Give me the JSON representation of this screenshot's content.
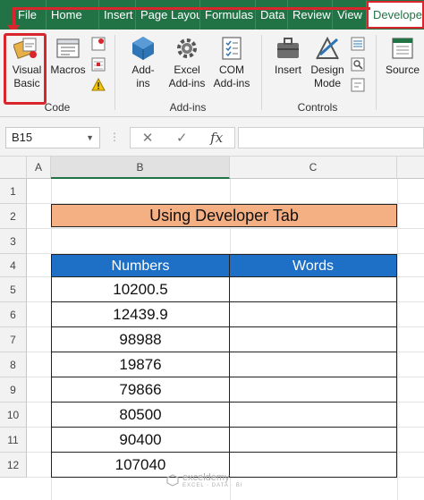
{
  "ribbon": {
    "tabs": [
      "File",
      "Home",
      "Insert",
      "Page Layou",
      "Formulas",
      "Data",
      "Review",
      "View",
      "Developer"
    ],
    "groups": {
      "code": {
        "label": "Code",
        "visual_basic_line1": "Visual",
        "visual_basic_line2": "Basic",
        "macros": "Macros"
      },
      "addins": {
        "label": "Add-ins",
        "addins_line1": "Add-",
        "addins_line2": "ins",
        "excel_addins_line1": "Excel",
        "excel_addins_line2": "Add-ins",
        "com_addins_line1": "COM",
        "com_addins_line2": "Add-ins"
      },
      "controls": {
        "label": "Controls",
        "insert": "Insert",
        "design_mode_line1": "Design",
        "design_mode_line2": "Mode"
      },
      "xml": {
        "source": "Source"
      }
    }
  },
  "formula_bar": {
    "name_box": "B15",
    "fx_label": "fx",
    "formula": ""
  },
  "sheet": {
    "columns": [
      "A",
      "B",
      "C"
    ],
    "rows": [
      "1",
      "2",
      "3",
      "4",
      "5",
      "6",
      "7",
      "8",
      "9",
      "10",
      "11",
      "12"
    ],
    "title": "Using Developer Tab",
    "headers": [
      "Numbers",
      "Words"
    ],
    "numbers": [
      "10200.5",
      "12439.9",
      "98988",
      "19876",
      "79866",
      "80500",
      "90400",
      "107040"
    ],
    "words": [
      "",
      "",
      "",
      "",
      "",
      "",
      "",
      ""
    ]
  },
  "watermark": {
    "brand": "exceldemy",
    "tagline": "EXCEL · DATA · BI"
  },
  "colors": {
    "ribbon_green": "#217346",
    "highlight_red": "#d9262c",
    "title_fill": "#f4b083",
    "header_fill": "#1e6fc6"
  }
}
